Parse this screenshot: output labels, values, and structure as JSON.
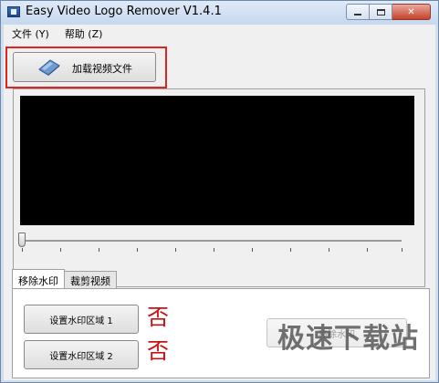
{
  "window": {
    "title": "Easy Video Logo Remover V1.4.1"
  },
  "menu": {
    "items": [
      "文件 (Y)",
      "帮助 (Z)"
    ]
  },
  "toolbar": {
    "load_label": "加载视频文件",
    "load_icon": "eraser-icon"
  },
  "tabs": {
    "items": [
      "移除水印",
      "裁剪视频"
    ],
    "active": "移除水印"
  },
  "panel": {
    "set_region_1": "设置水印区域 1",
    "set_region_2": "设置水印区域 2",
    "region_1_status": "否",
    "region_2_status": "否",
    "remove_label": "移除水印"
  },
  "watermark": {
    "text": "极速下载站"
  },
  "colors": {
    "highlight": "#e02424",
    "status_text": "#cc1111",
    "video_bg": "#000000"
  }
}
